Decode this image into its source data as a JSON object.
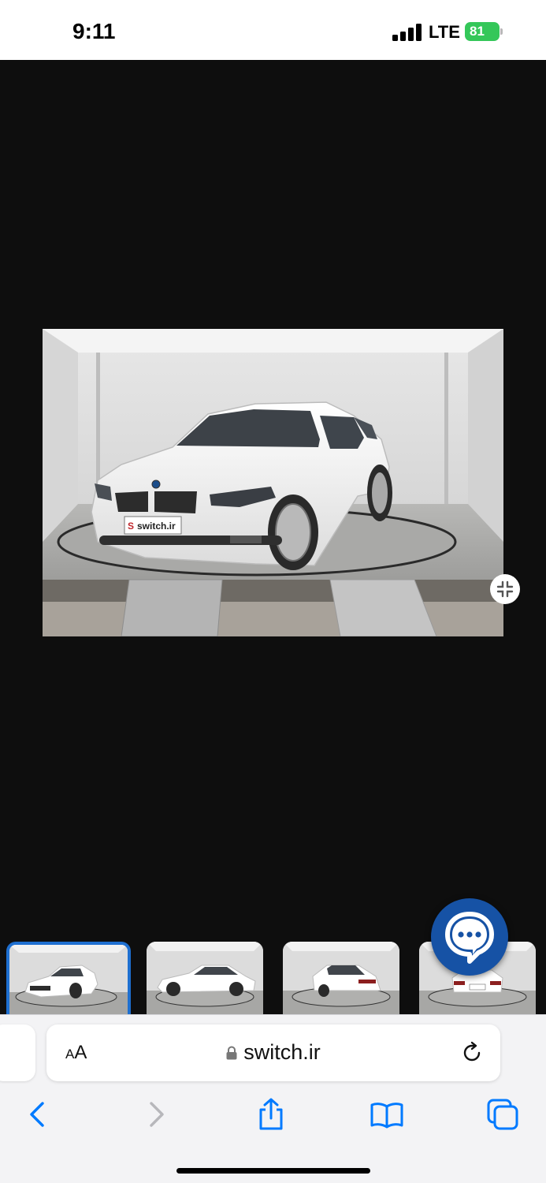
{
  "status_bar": {
    "time": "9:11",
    "network": "LTE",
    "battery": "81"
  },
  "viewer": {
    "watermark": "switch.ir",
    "thumbnails": [
      {
        "view": "front-left",
        "selected": true
      },
      {
        "view": "side-right",
        "selected": false
      },
      {
        "view": "rear-right",
        "selected": false
      },
      {
        "view": "rear",
        "selected": false
      }
    ]
  },
  "browser": {
    "text_size_label_small": "A",
    "text_size_label_large": "A",
    "url": "switch.ir"
  },
  "colors": {
    "accent": "#1e6fd0",
    "chat_fab": "#1652a5",
    "ios_blue": "#007aff",
    "battery_green": "#34c759"
  }
}
